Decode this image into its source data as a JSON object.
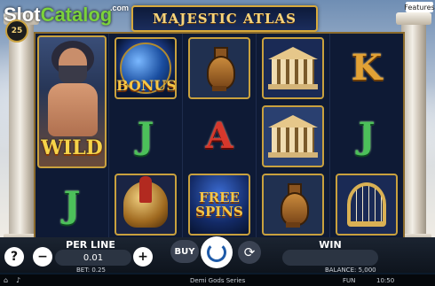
{
  "watermark": {
    "brand_slot": "Slot",
    "brand_catalog": "Catalog",
    "brand_com": ".com"
  },
  "header": {
    "title": "MAJESTIC ATLAS",
    "lines_badge": "25",
    "features_label": "Features"
  },
  "symbols": {
    "wild": "WILD",
    "bonus": "BONUS",
    "free_spins_line1": "FREE",
    "free_spins_line2": "SPINS",
    "letter_k": "K",
    "letter_j": "J",
    "letter_a": "A"
  },
  "controls": {
    "help": "?",
    "minus": "−",
    "plus": "+",
    "per_line_label": "PER LINE",
    "per_line_value": "0.01",
    "buy_label": "BUY",
    "autoplay_icon": "⟳",
    "win_label": "WIN"
  },
  "info": {
    "bet": "BET: 0.25",
    "balance": "BALANCE: 5,000"
  },
  "footer": {
    "series": "Demi Gods Series",
    "mode": "FUN",
    "time": "10:50"
  }
}
